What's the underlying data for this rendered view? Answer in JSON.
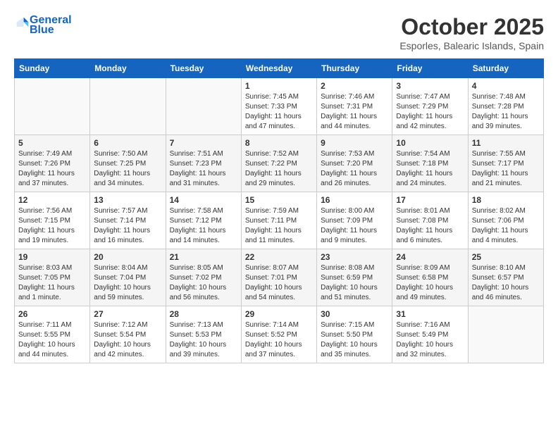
{
  "header": {
    "logo_line1": "General",
    "logo_line2": "Blue",
    "month": "October 2025",
    "location": "Esporles, Balearic Islands, Spain"
  },
  "weekdays": [
    "Sunday",
    "Monday",
    "Tuesday",
    "Wednesday",
    "Thursday",
    "Friday",
    "Saturday"
  ],
  "weeks": [
    [
      {
        "day": "",
        "info": ""
      },
      {
        "day": "",
        "info": ""
      },
      {
        "day": "",
        "info": ""
      },
      {
        "day": "1",
        "info": "Sunrise: 7:45 AM\nSunset: 7:33 PM\nDaylight: 11 hours\nand 47 minutes."
      },
      {
        "day": "2",
        "info": "Sunrise: 7:46 AM\nSunset: 7:31 PM\nDaylight: 11 hours\nand 44 minutes."
      },
      {
        "day": "3",
        "info": "Sunrise: 7:47 AM\nSunset: 7:29 PM\nDaylight: 11 hours\nand 42 minutes."
      },
      {
        "day": "4",
        "info": "Sunrise: 7:48 AM\nSunset: 7:28 PM\nDaylight: 11 hours\nand 39 minutes."
      }
    ],
    [
      {
        "day": "5",
        "info": "Sunrise: 7:49 AM\nSunset: 7:26 PM\nDaylight: 11 hours\nand 37 minutes."
      },
      {
        "day": "6",
        "info": "Sunrise: 7:50 AM\nSunset: 7:25 PM\nDaylight: 11 hours\nand 34 minutes."
      },
      {
        "day": "7",
        "info": "Sunrise: 7:51 AM\nSunset: 7:23 PM\nDaylight: 11 hours\nand 31 minutes."
      },
      {
        "day": "8",
        "info": "Sunrise: 7:52 AM\nSunset: 7:22 PM\nDaylight: 11 hours\nand 29 minutes."
      },
      {
        "day": "9",
        "info": "Sunrise: 7:53 AM\nSunset: 7:20 PM\nDaylight: 11 hours\nand 26 minutes."
      },
      {
        "day": "10",
        "info": "Sunrise: 7:54 AM\nSunset: 7:18 PM\nDaylight: 11 hours\nand 24 minutes."
      },
      {
        "day": "11",
        "info": "Sunrise: 7:55 AM\nSunset: 7:17 PM\nDaylight: 11 hours\nand 21 minutes."
      }
    ],
    [
      {
        "day": "12",
        "info": "Sunrise: 7:56 AM\nSunset: 7:15 PM\nDaylight: 11 hours\nand 19 minutes."
      },
      {
        "day": "13",
        "info": "Sunrise: 7:57 AM\nSunset: 7:14 PM\nDaylight: 11 hours\nand 16 minutes."
      },
      {
        "day": "14",
        "info": "Sunrise: 7:58 AM\nSunset: 7:12 PM\nDaylight: 11 hours\nand 14 minutes."
      },
      {
        "day": "15",
        "info": "Sunrise: 7:59 AM\nSunset: 7:11 PM\nDaylight: 11 hours\nand 11 minutes."
      },
      {
        "day": "16",
        "info": "Sunrise: 8:00 AM\nSunset: 7:09 PM\nDaylight: 11 hours\nand 9 minutes."
      },
      {
        "day": "17",
        "info": "Sunrise: 8:01 AM\nSunset: 7:08 PM\nDaylight: 11 hours\nand 6 minutes."
      },
      {
        "day": "18",
        "info": "Sunrise: 8:02 AM\nSunset: 7:06 PM\nDaylight: 11 hours\nand 4 minutes."
      }
    ],
    [
      {
        "day": "19",
        "info": "Sunrise: 8:03 AM\nSunset: 7:05 PM\nDaylight: 11 hours\nand 1 minute."
      },
      {
        "day": "20",
        "info": "Sunrise: 8:04 AM\nSunset: 7:04 PM\nDaylight: 10 hours\nand 59 minutes."
      },
      {
        "day": "21",
        "info": "Sunrise: 8:05 AM\nSunset: 7:02 PM\nDaylight: 10 hours\nand 56 minutes."
      },
      {
        "day": "22",
        "info": "Sunrise: 8:07 AM\nSunset: 7:01 PM\nDaylight: 10 hours\nand 54 minutes."
      },
      {
        "day": "23",
        "info": "Sunrise: 8:08 AM\nSunset: 6:59 PM\nDaylight: 10 hours\nand 51 minutes."
      },
      {
        "day": "24",
        "info": "Sunrise: 8:09 AM\nSunset: 6:58 PM\nDaylight: 10 hours\nand 49 minutes."
      },
      {
        "day": "25",
        "info": "Sunrise: 8:10 AM\nSunset: 6:57 PM\nDaylight: 10 hours\nand 46 minutes."
      }
    ],
    [
      {
        "day": "26",
        "info": "Sunrise: 7:11 AM\nSunset: 5:55 PM\nDaylight: 10 hours\nand 44 minutes."
      },
      {
        "day": "27",
        "info": "Sunrise: 7:12 AM\nSunset: 5:54 PM\nDaylight: 10 hours\nand 42 minutes."
      },
      {
        "day": "28",
        "info": "Sunrise: 7:13 AM\nSunset: 5:53 PM\nDaylight: 10 hours\nand 39 minutes."
      },
      {
        "day": "29",
        "info": "Sunrise: 7:14 AM\nSunset: 5:52 PM\nDaylight: 10 hours\nand 37 minutes."
      },
      {
        "day": "30",
        "info": "Sunrise: 7:15 AM\nSunset: 5:50 PM\nDaylight: 10 hours\nand 35 minutes."
      },
      {
        "day": "31",
        "info": "Sunrise: 7:16 AM\nSunset: 5:49 PM\nDaylight: 10 hours\nand 32 minutes."
      },
      {
        "day": "",
        "info": ""
      }
    ]
  ]
}
